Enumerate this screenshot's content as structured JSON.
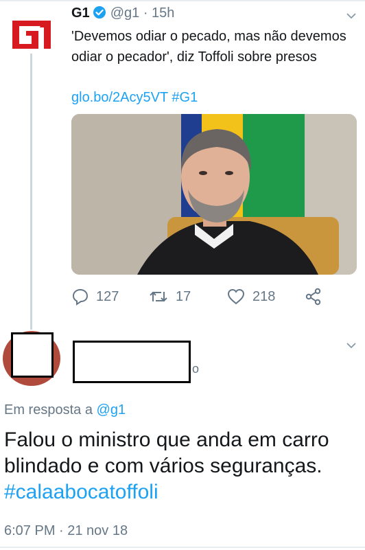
{
  "tweet": {
    "author_name": "G1",
    "handle": "@g1",
    "separator": "·",
    "time": "15h",
    "text": "'Devemos odiar o pecado, mas não devemos odiar o pecador', diz Toffoli sobre presos",
    "link": "glo.bo/2Acy5VT #G1",
    "replies": "127",
    "retweets": "17",
    "likes": "218",
    "logo_text": "G1",
    "brand_color": "#d71920",
    "verified_color": "#1da1f2"
  },
  "reply": {
    "handle_fragment": "o",
    "reply_prefix": "Em resposta a",
    "reply_mention": "@g1",
    "text": "Falou o ministro que anda em carro blindado e com  vários seguranças.",
    "hashtag": "#calaabocatoffoli",
    "timestamp": "6:07 PM · 21 nov 18"
  },
  "colors": {
    "link": "#1da1f2",
    "secondary_text": "#657786",
    "primary_text": "#14171a"
  }
}
